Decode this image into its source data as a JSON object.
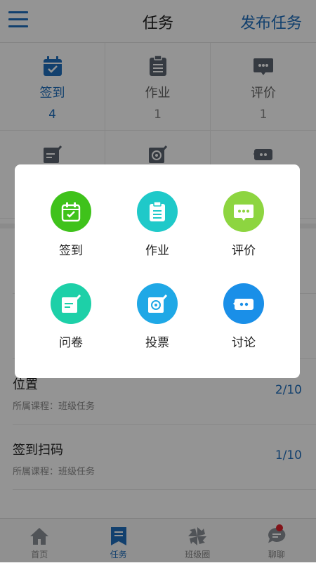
{
  "header": {
    "title": "任务",
    "publish_label": "发布任务",
    "menu_icon": "hamburger-menu-icon"
  },
  "grid": {
    "items": [
      {
        "label": "签到",
        "count": "4",
        "icon": "calendar-check-icon",
        "active": true
      },
      {
        "label": "作业",
        "count": "1",
        "icon": "clipboard-icon"
      },
      {
        "label": "评价",
        "count": "1",
        "icon": "comment-dots-icon"
      },
      {
        "icon": "questionnaire-icon"
      },
      {
        "icon": "vote-icon"
      },
      {
        "icon": "discussion-icon"
      }
    ]
  },
  "tasks": [
    {
      "title": "",
      "sub": "",
      "count": ""
    },
    {
      "title": "",
      "sub": "",
      "count": ""
    },
    {
      "title": "位置",
      "sub": "所属课程：班级任务",
      "count": "2/10"
    },
    {
      "title": "签到扫码",
      "sub": "所属课程：班级任务",
      "count": "1/10"
    }
  ],
  "modal": {
    "items": [
      {
        "label": "签到",
        "icon": "calendar-check-icon",
        "color": "#3fc21b"
      },
      {
        "label": "作业",
        "icon": "clipboard-icon",
        "color": "#1fc9c9"
      },
      {
        "label": "评价",
        "icon": "comment-dots-icon",
        "color": "#8dd540"
      },
      {
        "label": "问卷",
        "icon": "questionnaire-icon",
        "color": "#1dd0a8"
      },
      {
        "label": "投票",
        "icon": "vote-icon",
        "color": "#1fa8e6"
      },
      {
        "label": "讨论",
        "icon": "discussion-icon",
        "color": "#1a8fe8"
      }
    ]
  },
  "tabbar": {
    "items": [
      {
        "label": "首页",
        "icon": "home-icon"
      },
      {
        "label": "任务",
        "icon": "bookmark-list-icon",
        "active": true
      },
      {
        "label": "班级圈",
        "icon": "pinwheel-icon"
      },
      {
        "label": "聊聊",
        "icon": "chat-bubble-icon",
        "badge": true
      }
    ]
  },
  "colors": {
    "accent": "#1f6fbd",
    "badge": "#e0212b",
    "grid_icon": "#5c6470"
  }
}
